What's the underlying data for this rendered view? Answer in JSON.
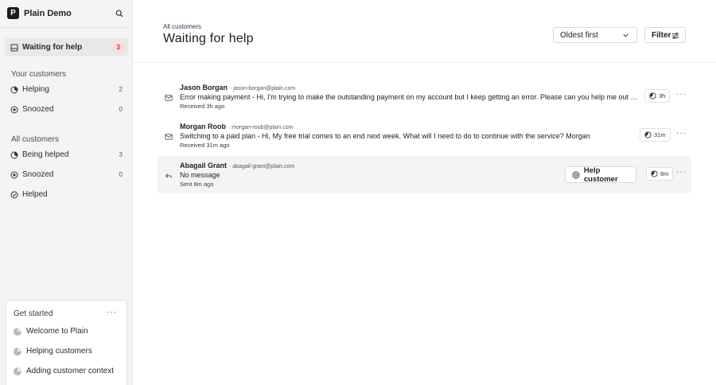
{
  "brand": {
    "name": "Plain Demo",
    "logo_letter": "P"
  },
  "sidebar": {
    "active_item": {
      "label": "Waiting for help",
      "count": "3"
    },
    "your_customers": {
      "label": "Your customers",
      "items": [
        {
          "label": "Helping",
          "count": "2"
        },
        {
          "label": "Snoozed",
          "count": "0"
        }
      ]
    },
    "all_customers": {
      "label": "All customers",
      "items": [
        {
          "label": "Being helped",
          "count": "3"
        },
        {
          "label": "Snoozed",
          "count": "0"
        },
        {
          "label": "Helped"
        }
      ]
    },
    "get_started": {
      "title": "Get started",
      "more": "···",
      "items": [
        {
          "label": "Welcome to Plain"
        },
        {
          "label": "Helping customers"
        },
        {
          "label": "Adding customer context"
        }
      ]
    }
  },
  "main": {
    "breadcrumb": "All customers",
    "title": "Waiting for help",
    "sort": {
      "value": "Oldest first"
    },
    "filter_label": "Filter",
    "rows": [
      {
        "name": "Jason Borgan",
        "email": "· jason-borgan@plain.com",
        "message": "Error making payment - Hi, I'm trying to make the outstanding payment on my account but I keep getting an error. Please can you help me out on this",
        "time": "Received 3h ago",
        "wait": "3h"
      },
      {
        "name": "Morgan Roob",
        "email": "· morgan-roob@plain.com",
        "message": "Switching to a paid plan - Hi, My free trial comes to an end next week. What will I need to do to continue with the service? Morgan",
        "time": "Received 31m ago",
        "wait": "31m"
      },
      {
        "name": "Abagail Grant",
        "email": "· abagail-grant@plain.com",
        "message": "No message",
        "time": "Sent 8m ago",
        "wait": "8m",
        "action": "Help customer"
      }
    ]
  },
  "colors": {
    "badge_bg": "#ffd8d4",
    "badge_text": "#c43b2c",
    "sidebar_bg": "#f4f4f5"
  }
}
